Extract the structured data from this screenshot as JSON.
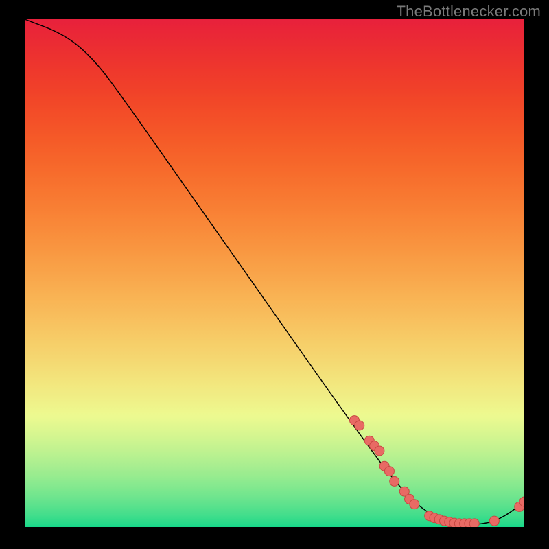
{
  "watermark": "TheBottlenecker.com",
  "chart_data": {
    "type": "line",
    "title": "",
    "xlabel": "",
    "ylabel": "",
    "xlim": [
      0,
      100
    ],
    "ylim": [
      0,
      100
    ],
    "curve": [
      {
        "x": 0,
        "y": 100
      },
      {
        "x": 8,
        "y": 97
      },
      {
        "x": 14,
        "y": 92
      },
      {
        "x": 20,
        "y": 84
      },
      {
        "x": 30,
        "y": 70
      },
      {
        "x": 40,
        "y": 56
      },
      {
        "x": 50,
        "y": 42
      },
      {
        "x": 60,
        "y": 28
      },
      {
        "x": 68,
        "y": 17
      },
      {
        "x": 74,
        "y": 9
      },
      {
        "x": 80,
        "y": 3
      },
      {
        "x": 86,
        "y": 0.5
      },
      {
        "x": 92,
        "y": 0.5
      },
      {
        "x": 96,
        "y": 2
      },
      {
        "x": 100,
        "y": 5
      }
    ],
    "markers": [
      {
        "x": 66,
        "y": 21
      },
      {
        "x": 67,
        "y": 20
      },
      {
        "x": 69,
        "y": 17
      },
      {
        "x": 70,
        "y": 16
      },
      {
        "x": 71,
        "y": 15
      },
      {
        "x": 72,
        "y": 12
      },
      {
        "x": 73,
        "y": 11
      },
      {
        "x": 74,
        "y": 9
      },
      {
        "x": 76,
        "y": 7
      },
      {
        "x": 77,
        "y": 5.5
      },
      {
        "x": 78,
        "y": 4.5
      },
      {
        "x": 81,
        "y": 2.2
      },
      {
        "x": 82,
        "y": 1.8
      },
      {
        "x": 83,
        "y": 1.5
      },
      {
        "x": 84,
        "y": 1.2
      },
      {
        "x": 85,
        "y": 1.0
      },
      {
        "x": 86,
        "y": 0.8
      },
      {
        "x": 87,
        "y": 0.7
      },
      {
        "x": 88,
        "y": 0.7
      },
      {
        "x": 89,
        "y": 0.7
      },
      {
        "x": 90,
        "y": 0.7
      },
      {
        "x": 94,
        "y": 1.2
      },
      {
        "x": 99,
        "y": 4
      },
      {
        "x": 100,
        "y": 5
      }
    ],
    "gradient_stops": [
      {
        "pos": 0.0,
        "color": "#e8213c"
      },
      {
        "pos": 0.006,
        "color": "#e8223b"
      },
      {
        "pos": 0.013,
        "color": "#e92339"
      },
      {
        "pos": 0.019,
        "color": "#e92538"
      },
      {
        "pos": 0.025,
        "color": "#ea2637"
      },
      {
        "pos": 0.032,
        "color": "#ea2836"
      },
      {
        "pos": 0.038,
        "color": "#ea2935"
      },
      {
        "pos": 0.044,
        "color": "#eb2b34"
      },
      {
        "pos": 0.051,
        "color": "#eb2c33"
      },
      {
        "pos": 0.057,
        "color": "#ec2e32"
      },
      {
        "pos": 0.063,
        "color": "#ec2f31"
      },
      {
        "pos": 0.07,
        "color": "#ed3130"
      },
      {
        "pos": 0.076,
        "color": "#ed322f"
      },
      {
        "pos": 0.082,
        "color": "#ed342f"
      },
      {
        "pos": 0.089,
        "color": "#ee352e"
      },
      {
        "pos": 0.095,
        "color": "#ee372d"
      },
      {
        "pos": 0.101,
        "color": "#ef382c"
      },
      {
        "pos": 0.108,
        "color": "#ef3a2c"
      },
      {
        "pos": 0.114,
        "color": "#ef3b2b"
      },
      {
        "pos": 0.12,
        "color": "#f03d2b"
      },
      {
        "pos": 0.127,
        "color": "#f03e2a"
      },
      {
        "pos": 0.133,
        "color": "#f0402a"
      },
      {
        "pos": 0.139,
        "color": "#f14129"
      },
      {
        "pos": 0.146,
        "color": "#f14329"
      },
      {
        "pos": 0.152,
        "color": "#f14529"
      },
      {
        "pos": 0.158,
        "color": "#f24628"
      },
      {
        "pos": 0.165,
        "color": "#f24828"
      },
      {
        "pos": 0.171,
        "color": "#f24928"
      },
      {
        "pos": 0.177,
        "color": "#f34b28"
      },
      {
        "pos": 0.184,
        "color": "#f34d28"
      },
      {
        "pos": 0.19,
        "color": "#f34e28"
      },
      {
        "pos": 0.196,
        "color": "#f35028"
      },
      {
        "pos": 0.203,
        "color": "#f45128"
      },
      {
        "pos": 0.209,
        "color": "#f45328"
      },
      {
        "pos": 0.215,
        "color": "#f45528"
      },
      {
        "pos": 0.222,
        "color": "#f45628"
      },
      {
        "pos": 0.228,
        "color": "#f55828"
      },
      {
        "pos": 0.234,
        "color": "#f55a28"
      },
      {
        "pos": 0.241,
        "color": "#f55b28"
      },
      {
        "pos": 0.247,
        "color": "#f55d29"
      },
      {
        "pos": 0.253,
        "color": "#f55f29"
      },
      {
        "pos": 0.259,
        "color": "#f66029"
      },
      {
        "pos": 0.266,
        "color": "#f6622a"
      },
      {
        "pos": 0.272,
        "color": "#f6642a"
      },
      {
        "pos": 0.278,
        "color": "#f6652a"
      },
      {
        "pos": 0.285,
        "color": "#f6672b"
      },
      {
        "pos": 0.291,
        "color": "#f7692b"
      },
      {
        "pos": 0.297,
        "color": "#f76a2c"
      },
      {
        "pos": 0.304,
        "color": "#f76c2c"
      },
      {
        "pos": 0.31,
        "color": "#f76e2d"
      },
      {
        "pos": 0.316,
        "color": "#f7702e"
      },
      {
        "pos": 0.323,
        "color": "#f7712e"
      },
      {
        "pos": 0.329,
        "color": "#f8732f"
      },
      {
        "pos": 0.335,
        "color": "#f87530"
      },
      {
        "pos": 0.342,
        "color": "#f87730"
      },
      {
        "pos": 0.348,
        "color": "#f87831"
      },
      {
        "pos": 0.354,
        "color": "#f87a32"
      },
      {
        "pos": 0.361,
        "color": "#f87c33"
      },
      {
        "pos": 0.367,
        "color": "#f87e33"
      },
      {
        "pos": 0.373,
        "color": "#f87f34"
      },
      {
        "pos": 0.38,
        "color": "#f98135"
      },
      {
        "pos": 0.386,
        "color": "#f98336"
      },
      {
        "pos": 0.392,
        "color": "#f98537"
      },
      {
        "pos": 0.399,
        "color": "#f98738"
      },
      {
        "pos": 0.405,
        "color": "#f98839"
      },
      {
        "pos": 0.411,
        "color": "#f98a3a"
      },
      {
        "pos": 0.418,
        "color": "#f98c3b"
      },
      {
        "pos": 0.424,
        "color": "#f98e3c"
      },
      {
        "pos": 0.43,
        "color": "#f9903d"
      },
      {
        "pos": 0.437,
        "color": "#f9923e"
      },
      {
        "pos": 0.443,
        "color": "#f9933f"
      },
      {
        "pos": 0.449,
        "color": "#f99540"
      },
      {
        "pos": 0.456,
        "color": "#f99741"
      },
      {
        "pos": 0.462,
        "color": "#f99942"
      },
      {
        "pos": 0.468,
        "color": "#f99b44"
      },
      {
        "pos": 0.475,
        "color": "#f99d45"
      },
      {
        "pos": 0.481,
        "color": "#f99f46"
      },
      {
        "pos": 0.487,
        "color": "#f9a147"
      },
      {
        "pos": 0.494,
        "color": "#f9a248"
      },
      {
        "pos": 0.5,
        "color": "#f9a44a"
      },
      {
        "pos": 0.506,
        "color": "#f9a64b"
      },
      {
        "pos": 0.513,
        "color": "#f9a84c"
      },
      {
        "pos": 0.519,
        "color": "#f9aa4e"
      },
      {
        "pos": 0.525,
        "color": "#f9ac4f"
      },
      {
        "pos": 0.532,
        "color": "#f9ae50"
      },
      {
        "pos": 0.538,
        "color": "#f9b052"
      },
      {
        "pos": 0.544,
        "color": "#f9b253"
      },
      {
        "pos": 0.551,
        "color": "#f9b454"
      },
      {
        "pos": 0.557,
        "color": "#f9b656"
      },
      {
        "pos": 0.563,
        "color": "#f8b757"
      },
      {
        "pos": 0.57,
        "color": "#f8b959"
      },
      {
        "pos": 0.576,
        "color": "#f8bb5a"
      },
      {
        "pos": 0.582,
        "color": "#f8bd5c"
      },
      {
        "pos": 0.589,
        "color": "#f8bf5d"
      },
      {
        "pos": 0.595,
        "color": "#f8c15f"
      },
      {
        "pos": 0.601,
        "color": "#f7c360"
      },
      {
        "pos": 0.608,
        "color": "#f7c562"
      },
      {
        "pos": 0.614,
        "color": "#f7c763"
      },
      {
        "pos": 0.62,
        "color": "#f7c965"
      },
      {
        "pos": 0.627,
        "color": "#f7cb66"
      },
      {
        "pos": 0.633,
        "color": "#f6cd68"
      },
      {
        "pos": 0.639,
        "color": "#f6cf69"
      },
      {
        "pos": 0.646,
        "color": "#f6d16b"
      },
      {
        "pos": 0.652,
        "color": "#f6d26d"
      },
      {
        "pos": 0.658,
        "color": "#f5d46e"
      },
      {
        "pos": 0.665,
        "color": "#f5d670"
      },
      {
        "pos": 0.671,
        "color": "#f5d872"
      },
      {
        "pos": 0.677,
        "color": "#f4da73"
      },
      {
        "pos": 0.684,
        "color": "#f4dc75"
      },
      {
        "pos": 0.69,
        "color": "#f4de77"
      },
      {
        "pos": 0.696,
        "color": "#f3e078"
      },
      {
        "pos": 0.703,
        "color": "#f3e27a"
      },
      {
        "pos": 0.709,
        "color": "#f3e47c"
      },
      {
        "pos": 0.715,
        "color": "#f2e67d"
      },
      {
        "pos": 0.722,
        "color": "#f2e87f"
      },
      {
        "pos": 0.728,
        "color": "#f1ea81"
      },
      {
        "pos": 0.734,
        "color": "#f1eb83"
      },
      {
        "pos": 0.741,
        "color": "#f0ed84"
      },
      {
        "pos": 0.747,
        "color": "#f0ef86"
      },
      {
        "pos": 0.753,
        "color": "#eff188"
      },
      {
        "pos": 0.759,
        "color": "#eff38a"
      },
      {
        "pos": 0.766,
        "color": "#eef58b"
      },
      {
        "pos": 0.772,
        "color": "#eef78d"
      },
      {
        "pos": 0.778,
        "color": "#edf98f"
      },
      {
        "pos": 0.785,
        "color": "#ebf990"
      },
      {
        "pos": 0.791,
        "color": "#e7f990"
      },
      {
        "pos": 0.797,
        "color": "#e3f890"
      },
      {
        "pos": 0.804,
        "color": "#dff790"
      },
      {
        "pos": 0.81,
        "color": "#dbf790"
      },
      {
        "pos": 0.816,
        "color": "#d7f690"
      },
      {
        "pos": 0.823,
        "color": "#d3f590"
      },
      {
        "pos": 0.829,
        "color": "#cef590"
      },
      {
        "pos": 0.835,
        "color": "#caf490"
      },
      {
        "pos": 0.842,
        "color": "#c5f390"
      },
      {
        "pos": 0.848,
        "color": "#c1f290"
      },
      {
        "pos": 0.854,
        "color": "#bcf290"
      },
      {
        "pos": 0.861,
        "color": "#b7f190"
      },
      {
        "pos": 0.867,
        "color": "#b2f090"
      },
      {
        "pos": 0.873,
        "color": "#adef90"
      },
      {
        "pos": 0.88,
        "color": "#a8ee90"
      },
      {
        "pos": 0.886,
        "color": "#a3ed90"
      },
      {
        "pos": 0.892,
        "color": "#9dec8f"
      },
      {
        "pos": 0.899,
        "color": "#98ec8f"
      },
      {
        "pos": 0.905,
        "color": "#92eb8f"
      },
      {
        "pos": 0.911,
        "color": "#8cea8f"
      },
      {
        "pos": 0.918,
        "color": "#86e98f"
      },
      {
        "pos": 0.924,
        "color": "#80e88e"
      },
      {
        "pos": 0.93,
        "color": "#79e78e"
      },
      {
        "pos": 0.937,
        "color": "#73e68e"
      },
      {
        "pos": 0.943,
        "color": "#6ce48e"
      },
      {
        "pos": 0.949,
        "color": "#65e38d"
      },
      {
        "pos": 0.956,
        "color": "#5de28d"
      },
      {
        "pos": 0.962,
        "color": "#55e18c"
      },
      {
        "pos": 0.968,
        "color": "#4ddf8c"
      },
      {
        "pos": 0.975,
        "color": "#45de8c"
      },
      {
        "pos": 0.981,
        "color": "#3bdd8b"
      },
      {
        "pos": 0.987,
        "color": "#31db8a"
      },
      {
        "pos": 0.994,
        "color": "#25da8a"
      },
      {
        "pos": 1.0,
        "color": "#14d889"
      }
    ],
    "marker_style": {
      "fill": "#e86a64",
      "stroke": "#c74842",
      "r": 7
    },
    "line_style": {
      "stroke": "#000000",
      "width": 1.5
    }
  }
}
